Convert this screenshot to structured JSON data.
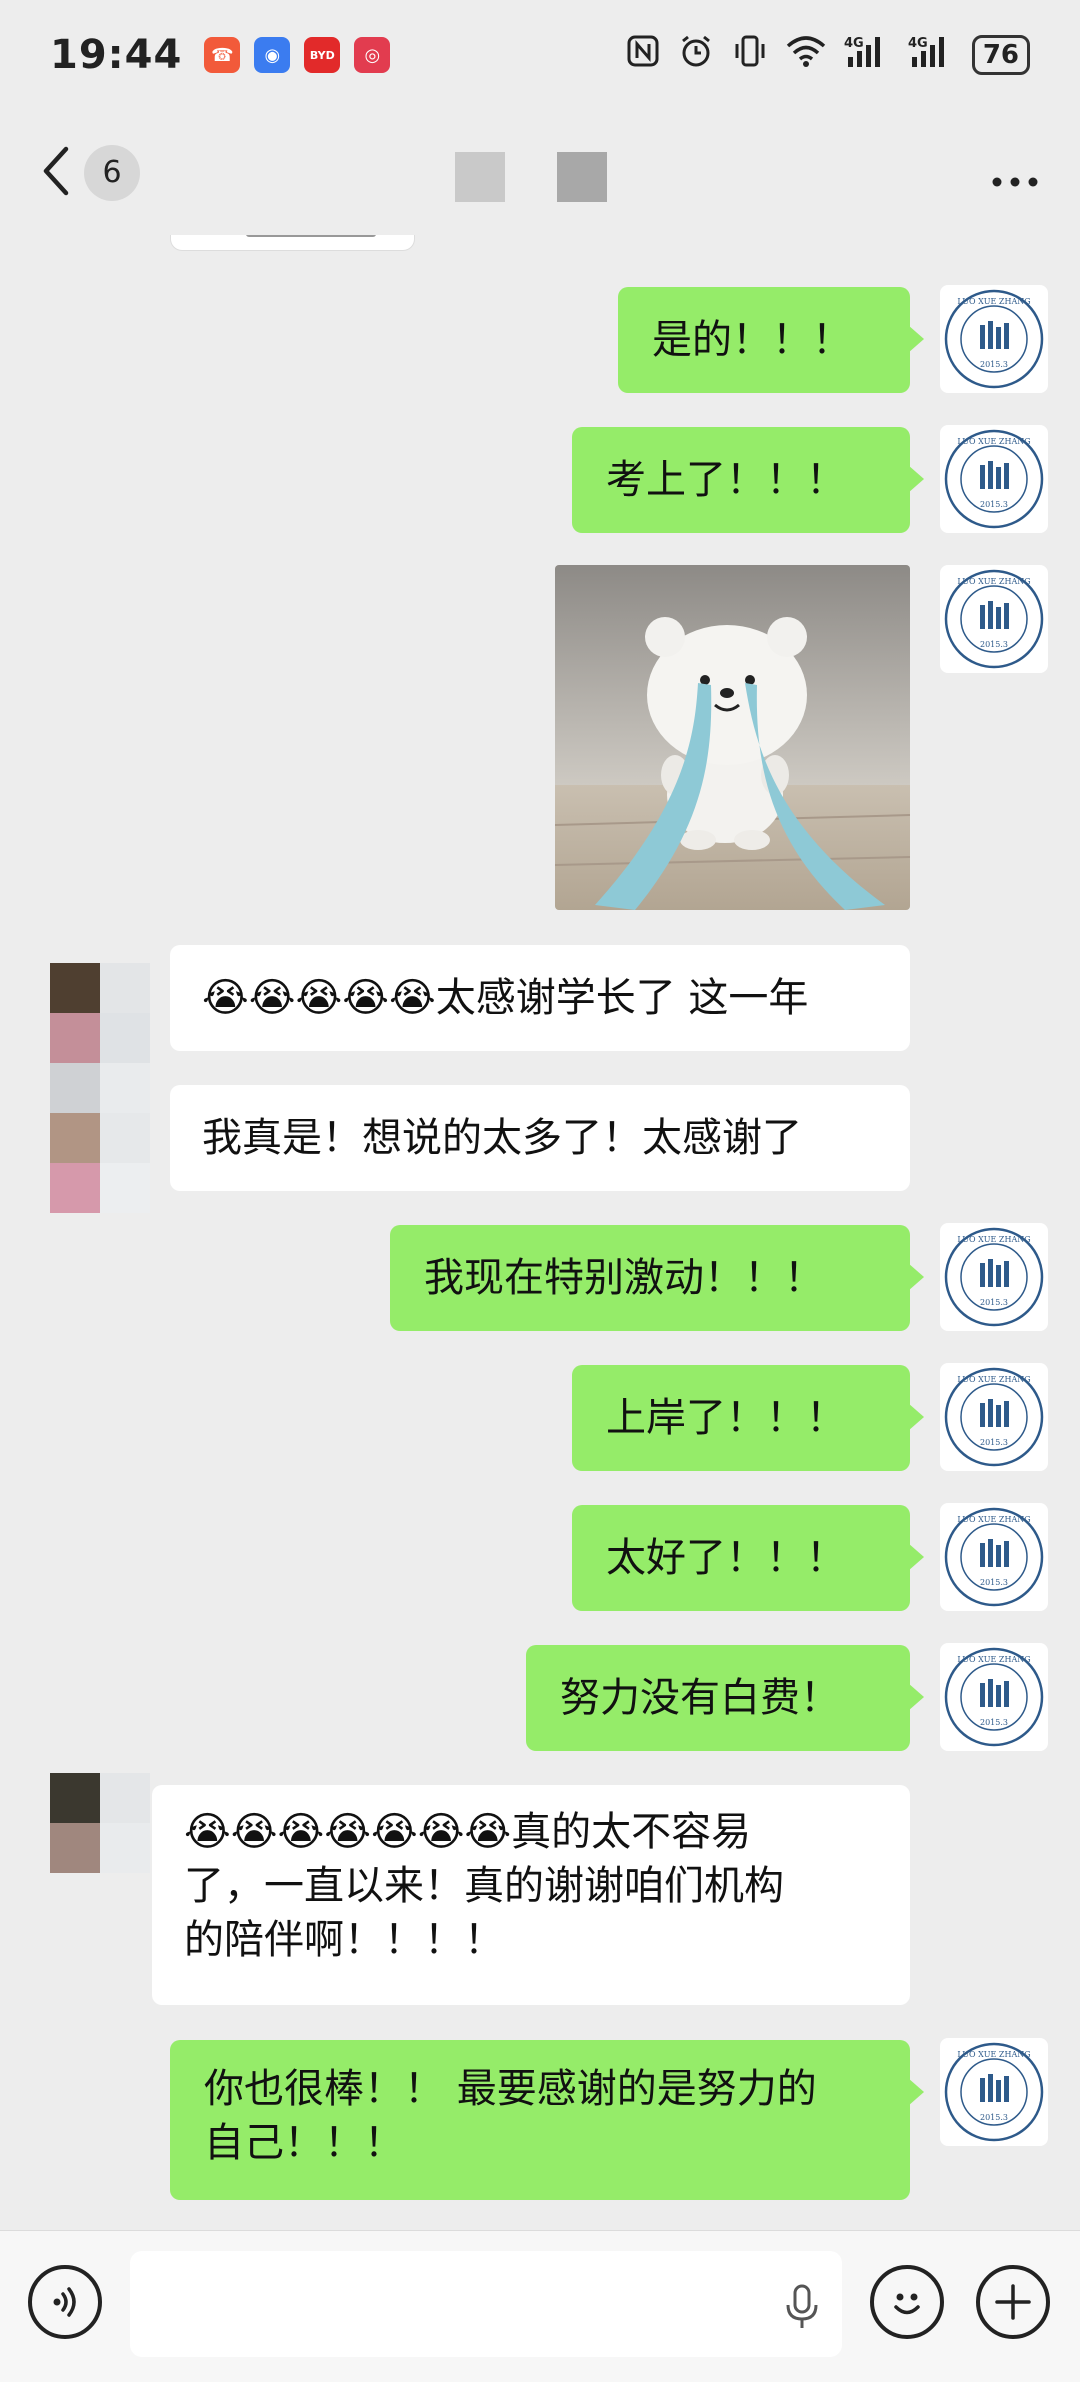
{
  "status_bar": {
    "time": "19:44",
    "notification_icons": [
      {
        "name": "missed-call-icon",
        "color": "#f25a3a",
        "glyph": "☎"
      },
      {
        "name": "app-blue-icon",
        "color": "#3b7cf0",
        "glyph": "◉"
      },
      {
        "name": "byd-app-icon",
        "color": "#e22a2a",
        "glyph": "BYD"
      },
      {
        "name": "app-red-icon",
        "color": "#e23c4f",
        "glyph": "◎"
      }
    ],
    "battery": "76"
  },
  "nav_bar": {
    "unread_count": "6"
  },
  "messages": [
    {
      "id": "m1",
      "direction": "out",
      "type": "text",
      "text": "是的！！！"
    },
    {
      "id": "m2",
      "direction": "out",
      "type": "text",
      "text": "考上了！！！"
    },
    {
      "id": "m3",
      "direction": "out",
      "type": "image",
      "image_desc": "crying-bear-plush"
    },
    {
      "id": "m4",
      "direction": "in",
      "type": "text",
      "text": "😭😭😭😭😭太感谢学长了 这一年"
    },
    {
      "id": "m5",
      "direction": "in",
      "type": "text",
      "text": "我真是！想说的太多了！太感谢了"
    },
    {
      "id": "m6",
      "direction": "out",
      "type": "text",
      "text": "我现在特别激动！！！"
    },
    {
      "id": "m7",
      "direction": "out",
      "type": "text",
      "text": "上岸了！！！"
    },
    {
      "id": "m8",
      "direction": "out",
      "type": "text",
      "text": "太好了！！！"
    },
    {
      "id": "m9",
      "direction": "out",
      "type": "text",
      "text": "努力没有白费！"
    },
    {
      "id": "m10",
      "direction": "in",
      "type": "text",
      "lines": [
        "😭😭😭😭😭😭😭真的太不容易",
        "了，一直以来！真的谢谢咱们机构",
        "的陪伴啊！！！！"
      ]
    },
    {
      "id": "m11",
      "direction": "out",
      "type": "text",
      "lines": [
        "你也很棒！！ 最要感谢的是努力的",
        "自己！！！"
      ]
    }
  ],
  "self_avatar": {
    "arc_text": "LUO XUE ZHANG KAO YAN",
    "year": "2015.3",
    "accent": "#2e5a8a"
  },
  "colors": {
    "background": "#ededed",
    "outgoing_bubble": "#95ec69",
    "incoming_bubble": "#ffffff"
  }
}
